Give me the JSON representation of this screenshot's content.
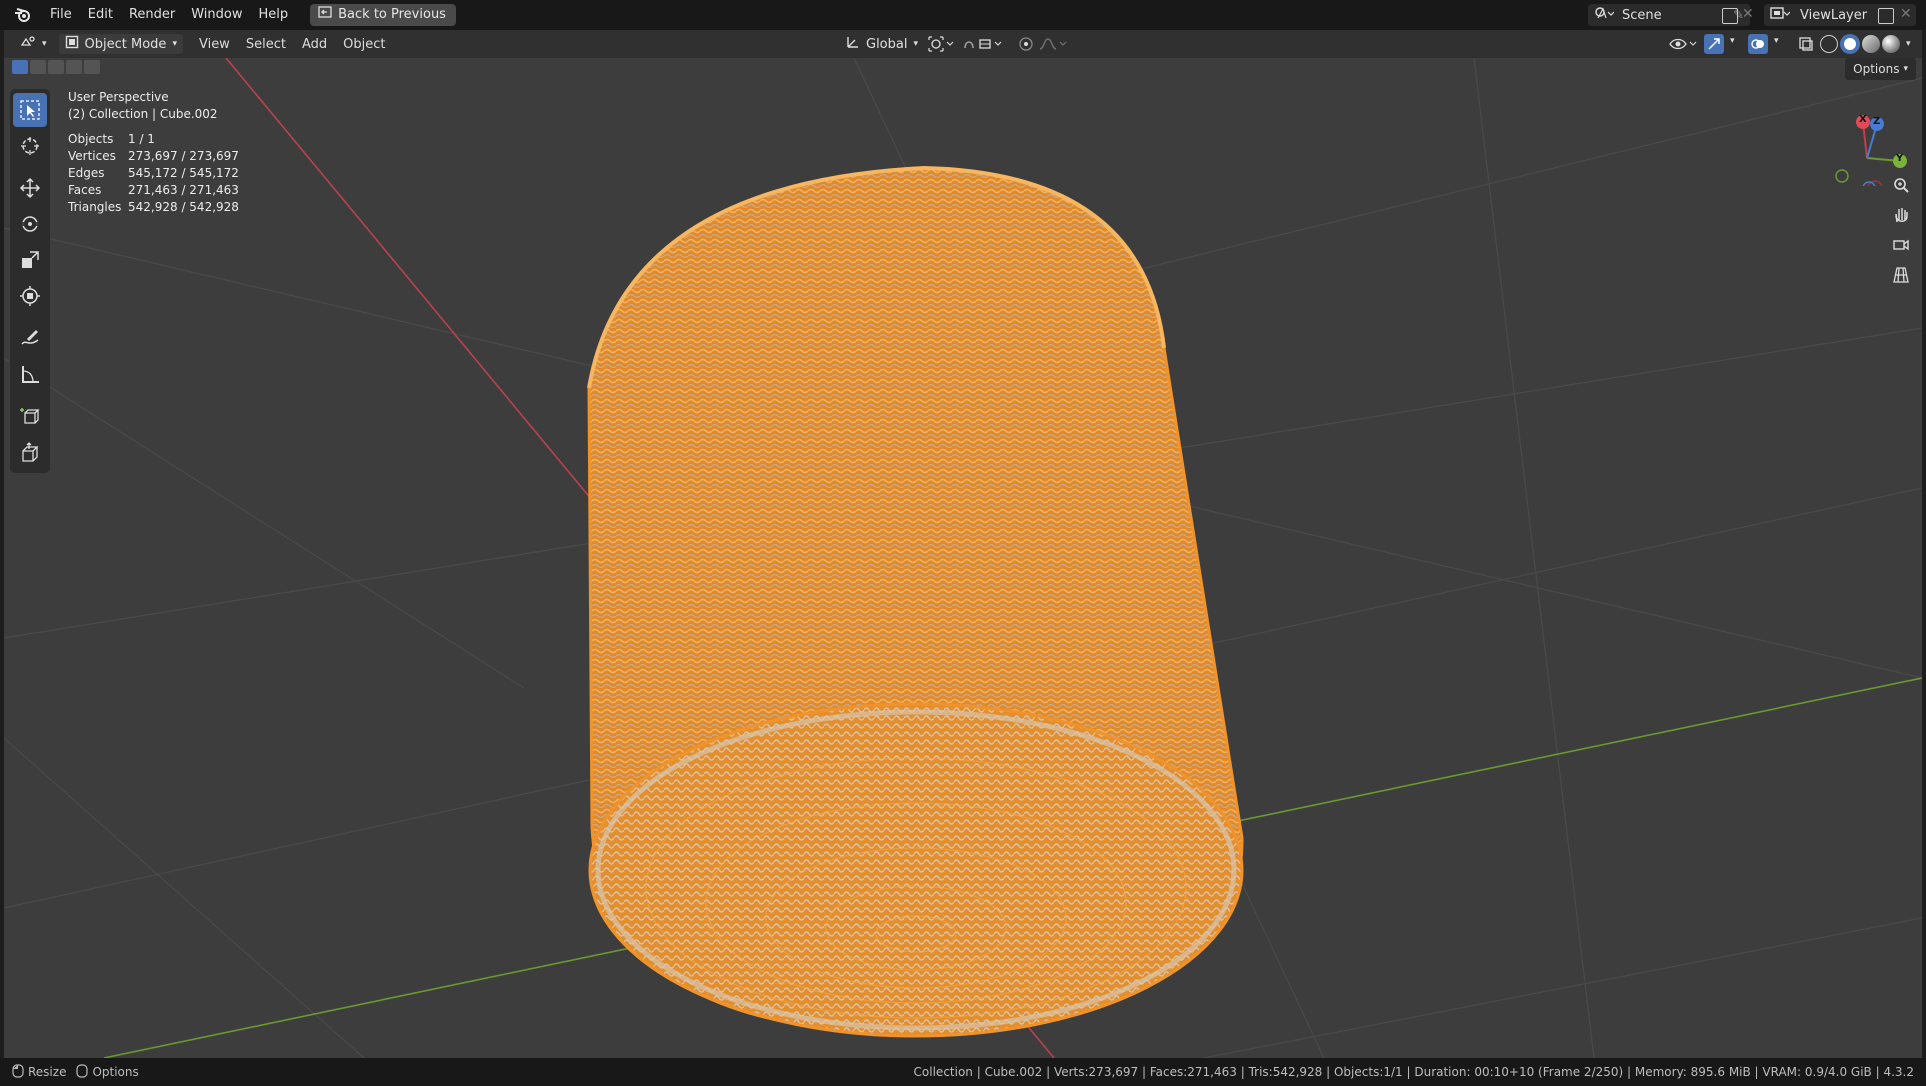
{
  "topbar": {
    "menus": [
      "File",
      "Edit",
      "Render",
      "Window",
      "Help"
    ],
    "back_button": "Back to Previous",
    "scene_label": "Scene",
    "view_layer_label": "ViewLayer"
  },
  "header": {
    "mode": "Object Mode",
    "menus": [
      "View",
      "Select",
      "Add",
      "Object"
    ],
    "transform_orientation": "Global",
    "options_label": "Options"
  },
  "viewport": {
    "perspective_label": "User Perspective",
    "collection_label": "(2) Collection | Cube.002",
    "stats": [
      {
        "label": "Objects",
        "value": "1 / 1"
      },
      {
        "label": "Vertices",
        "value": "273,697 / 273,697"
      },
      {
        "label": "Edges",
        "value": "545,172 / 545,172"
      },
      {
        "label": "Faces",
        "value": "271,463 / 271,463"
      },
      {
        "label": "Triangles",
        "value": "542,928 / 542,928"
      }
    ],
    "gizmo": {
      "x": "X",
      "y": "Y",
      "z": "Z"
    }
  },
  "toolbar": {
    "tools": [
      "select-box-icon",
      "cursor-icon",
      "move-icon",
      "rotate-icon",
      "scale-icon",
      "transform-icon",
      "annotate-icon",
      "measure-icon",
      "add-cube-icon",
      "extrude-icon"
    ]
  },
  "statusbar": {
    "left_1": "Resize",
    "left_2": "Options",
    "right": "Collection | Cube.002 | Verts:273,697 | Faces:271,463 | Tris:542,928 | Objects:1/1 | Duration: 00:10+10 (Frame 2/250) | Memory: 895.6 MiB | VRAM: 0.9/4.0 GiB | 4.3.2"
  },
  "colors": {
    "viewport_bg": "#3d3d3d",
    "selection_orange": "#f0932a",
    "x_axis": "#b8434d",
    "y_axis": "#6a9a2e",
    "accent_blue": "#4772b3"
  }
}
